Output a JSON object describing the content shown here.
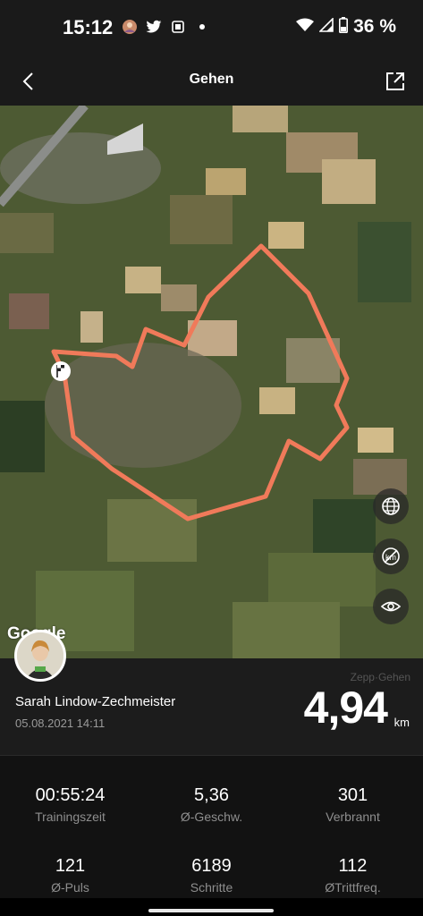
{
  "status_bar": {
    "time": "15:12",
    "battery": "36 %",
    "icons": [
      "contact-avatar-icon",
      "twitter-icon",
      "notification-icon",
      "dot-icon",
      "wifi-icon",
      "signal-icon",
      "battery-icon"
    ]
  },
  "header": {
    "title": "Gehen",
    "back_icon": "chevron-left-icon",
    "share_icon": "share-icon"
  },
  "map": {
    "attribution": "Google",
    "route_color": "#f07a5a",
    "start_icon": "finish-flag-icon",
    "controls": [
      "globe-icon",
      "distance-marker-hidden-icon",
      "eye-icon"
    ]
  },
  "profile": {
    "name": "Sarah Lindow-Zechmeister",
    "date": "05.08.2021 14:11",
    "source": "Zepp·Gehen",
    "distance": "4,94",
    "distance_unit": "km"
  },
  "stats": [
    {
      "value": "00:55:24",
      "label": "Trainingszeit"
    },
    {
      "value": "5,36",
      "label": "Ø-Geschw."
    },
    {
      "value": "301",
      "label": "Verbrannt"
    },
    {
      "value": "121",
      "label": "Ø-Puls"
    },
    {
      "value": "6189",
      "label": "Schritte"
    },
    {
      "value": "112",
      "label": "ØTrittfreq."
    }
  ]
}
